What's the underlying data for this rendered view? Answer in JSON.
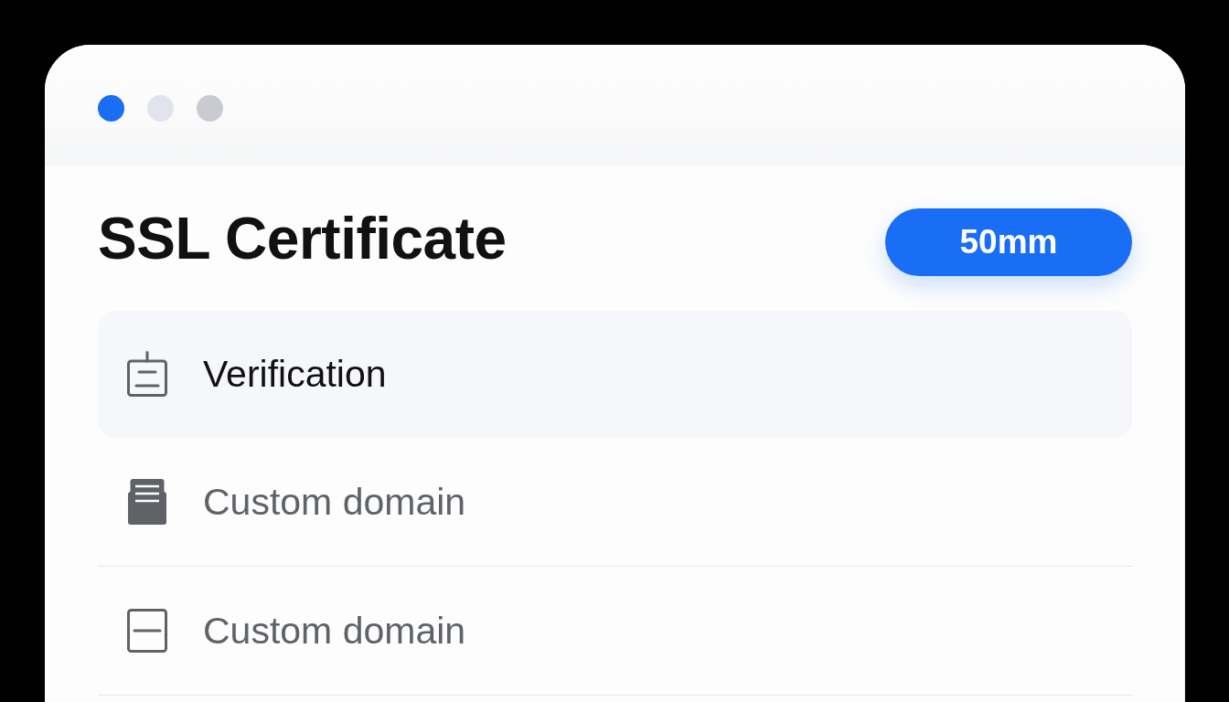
{
  "window": {
    "controls": [
      {
        "color": "#1a6ef5"
      },
      {
        "color": "#e1e4ea"
      },
      {
        "color": "#c9cbd0"
      }
    ]
  },
  "header": {
    "title": "SSL Certificate",
    "button": "50mm"
  },
  "items": [
    {
      "label": "Verification",
      "selected": true
    },
    {
      "label": "Custom domain",
      "selected": false
    },
    {
      "label": "Custom domain",
      "selected": false
    }
  ]
}
